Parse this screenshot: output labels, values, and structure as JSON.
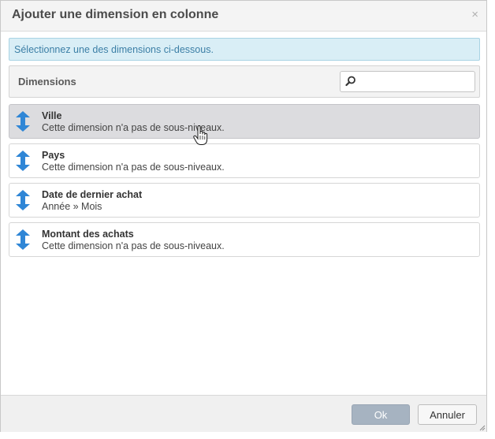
{
  "dialog": {
    "title": "Ajouter une dimension en colonne",
    "close_glyph": "×"
  },
  "info": {
    "message": "Sélectionnez une des dimensions ci-dessous."
  },
  "dimensions_bar": {
    "label": "Dimensions",
    "search_value": "",
    "search_icon": "search-icon"
  },
  "items": [
    {
      "name": "Ville",
      "description": "Cette dimension n'a pas de sous-niveaux.",
      "icon": "up-down-arrow-icon",
      "hover": true
    },
    {
      "name": "Pays",
      "description": "Cette dimension n'a pas de sous-niveaux.",
      "icon": "up-down-arrow-icon",
      "hover": false
    },
    {
      "name": "Date de dernier achat",
      "description": "Année » Mois",
      "icon": "up-down-arrow-icon",
      "hover": false
    },
    {
      "name": "Montant des achats",
      "description": "Cette dimension n'a pas de sous-niveaux.",
      "icon": "up-down-arrow-icon",
      "hover": false
    }
  ],
  "footer": {
    "ok_label": "Ok",
    "cancel_label": "Annuler"
  },
  "colors": {
    "arrow_blue": "#2f86d6",
    "info_bg": "#d9eef6",
    "info_text": "#3c7fa6",
    "ok_bg": "#a6b3c1"
  }
}
